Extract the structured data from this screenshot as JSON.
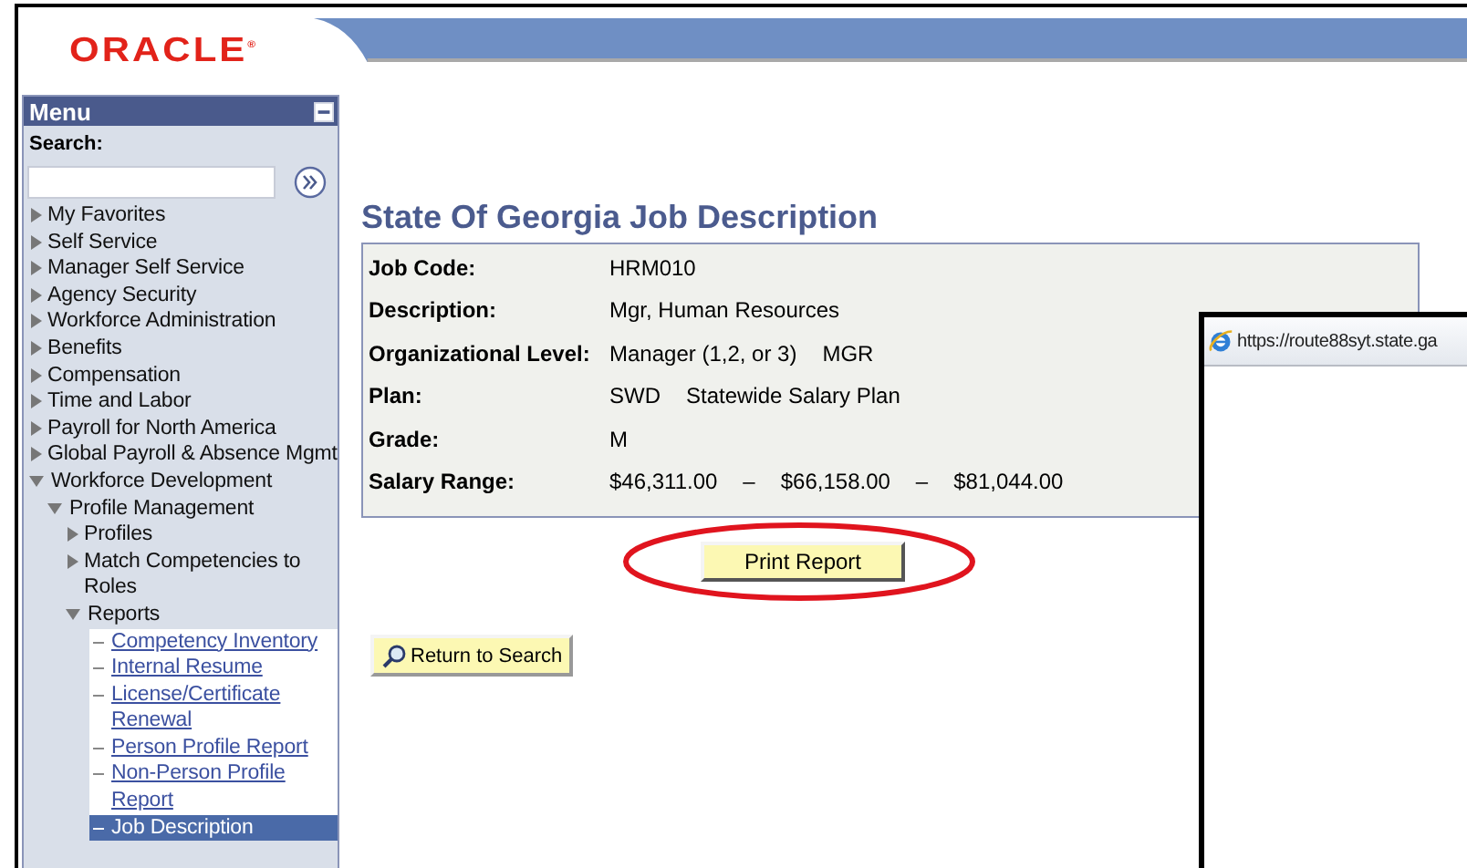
{
  "logo": "ORACLE$^{®}$",
  "menu": {
    "title": "Menu",
    "search_label": "Search:",
    "items": [
      {
        "kind": "folder",
        "label": "My Favorites",
        "expanded": false
      },
      {
        "kind": "folder",
        "label": "Self Service",
        "expanded": false
      },
      {
        "kind": "folder",
        "label": "Manager Self Service",
        "expanded": false
      },
      {
        "kind": "folder",
        "label": "Agency Security",
        "expanded": false
      },
      {
        "kind": "folder",
        "label": "Workforce Administration",
        "expanded": false
      },
      {
        "kind": "folder",
        "label": "Benefits",
        "expanded": false
      },
      {
        "kind": "folder",
        "label": "Compensation",
        "expanded": false
      },
      {
        "kind": "folder",
        "label": "Time and Labor",
        "expanded": false
      },
      {
        "kind": "folder",
        "label": "Payroll for North America",
        "expanded": false
      },
      {
        "kind": "folder",
        "label": "Global Payroll & Absence Mgmt",
        "expanded": false
      },
      {
        "kind": "folder",
        "label": "Workforce Development",
        "expanded": true,
        "children": [
          {
            "kind": "folder",
            "label": "Profile Management",
            "expanded": true,
            "children": [
              {
                "kind": "folder",
                "label": "Profiles",
                "expanded": false
              },
              {
                "kind": "folder",
                "label": "Match Competencies to Roles",
                "expanded": false
              },
              {
                "kind": "folder",
                "label": "Reports",
                "expanded": true,
                "children": [
                  {
                    "kind": "link",
                    "label": "Competency Inventory",
                    "selected": false
                  },
                  {
                    "kind": "link",
                    "label": "Internal Resume",
                    "selected": false
                  },
                  {
                    "kind": "link",
                    "label": "License/Certificate Renewal",
                    "selected": false
                  },
                  {
                    "kind": "link",
                    "label": "Person Profile Report",
                    "selected": false
                  },
                  {
                    "kind": "link",
                    "label": "Non-Person Profile Report",
                    "selected": false
                  },
                  {
                    "kind": "link",
                    "label": "Job Description",
                    "selected": true
                  }
                ]
              }
            ]
          }
        ]
      }
    ]
  },
  "page_title": "State Of Georgia Job Description",
  "fields": [
    {
      "label": "Job Code:",
      "values": [
        "HRM010"
      ]
    },
    {
      "label": "Description:",
      "values": [
        "Mgr, Human Resources"
      ]
    },
    {
      "label": "Organizational Level:",
      "values": [
        "Manager (1,2, or 3)",
        "MGR"
      ]
    },
    {
      "label": "Plan:",
      "values": [
        "SWD",
        "Statewide Salary Plan"
      ]
    },
    {
      "label": "Grade:",
      "values": [
        "M"
      ]
    },
    {
      "label": "Salary Range:",
      "values": [
        "$46,311.00",
        "–",
        "$66,158.00",
        "–",
        "$81,044.00"
      ]
    }
  ],
  "print_button": {
    "label": "Print Report",
    "circled": true
  },
  "return_button": {
    "label": "Return to Search"
  },
  "popup": {
    "url": "https://route88syt.state.ga"
  }
}
